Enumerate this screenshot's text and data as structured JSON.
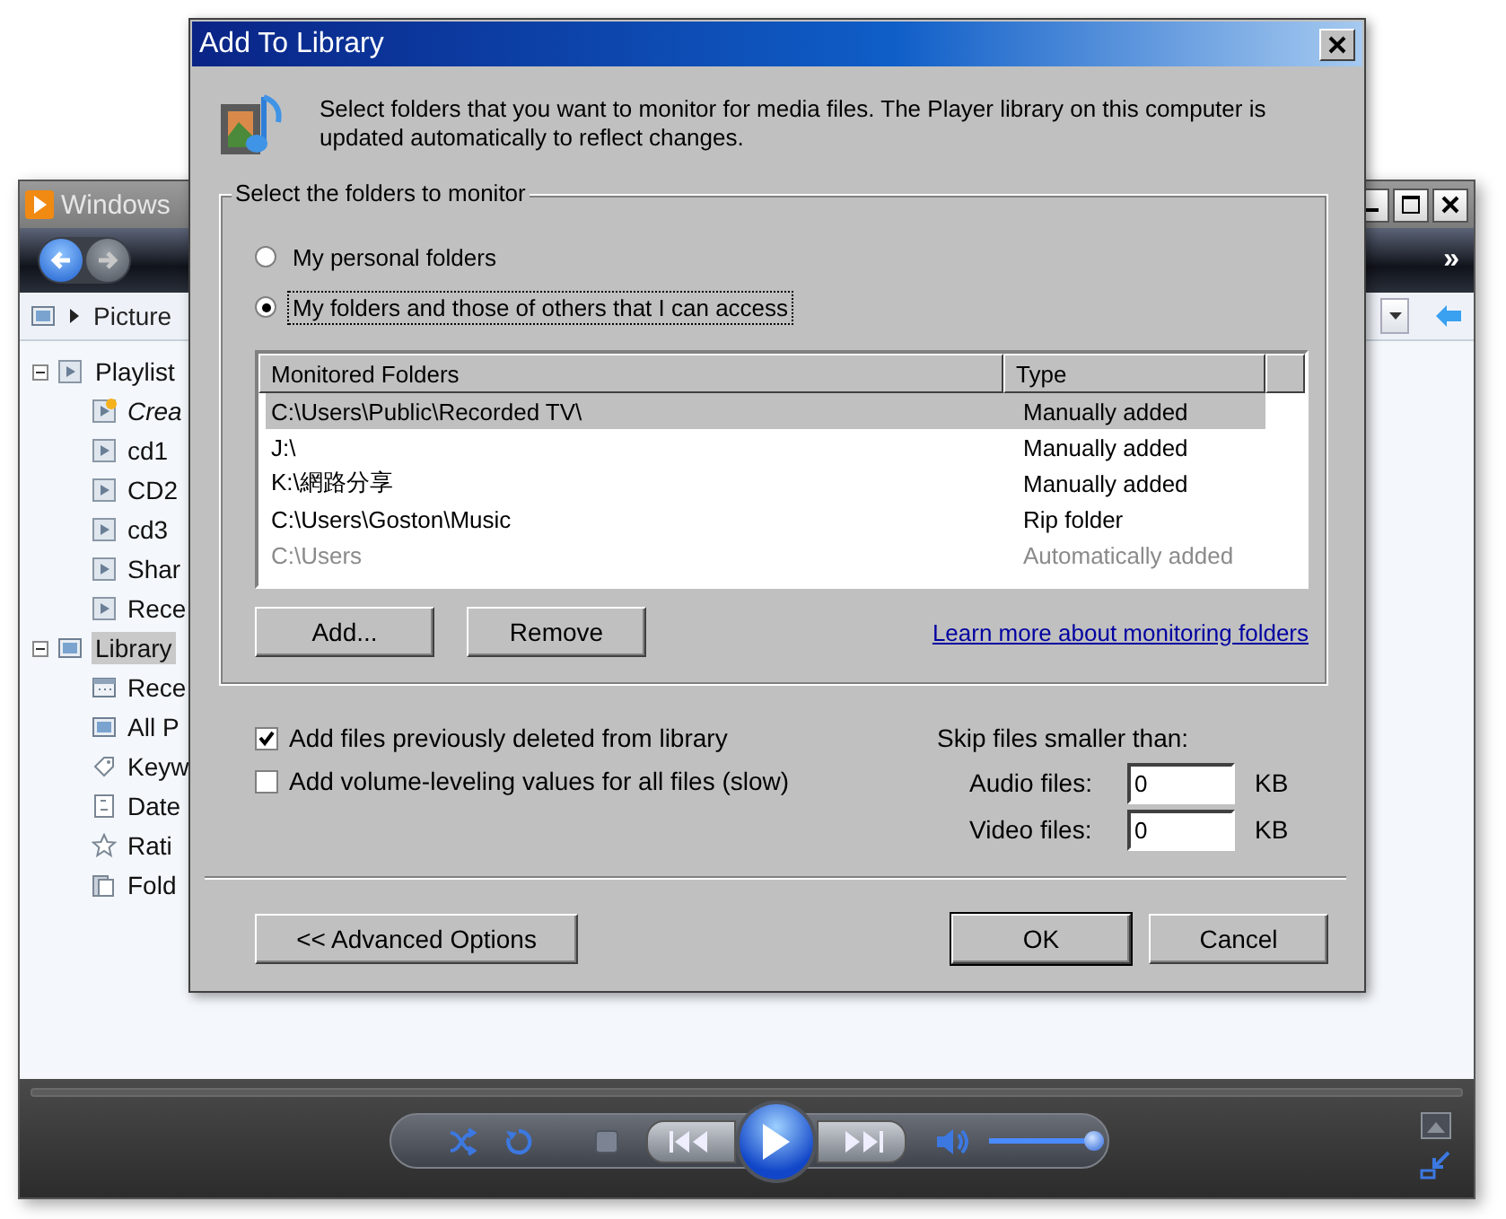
{
  "background_window": {
    "title": "Windows",
    "overflow": "»",
    "address": {
      "crumb": "Picture"
    },
    "tree": [
      {
        "label": "Playlist",
        "kind": "playlists",
        "expanded": true,
        "selected": false,
        "children": [
          {
            "label": "Crea",
            "kind": "new",
            "selected": false
          },
          {
            "label": "cd1",
            "kind": "playlist",
            "selected": false
          },
          {
            "label": "CD2",
            "kind": "playlist",
            "selected": false
          },
          {
            "label": "cd3",
            "kind": "playlist",
            "selected": false
          },
          {
            "label": "Shar",
            "kind": "playlist",
            "selected": false
          },
          {
            "label": "Rece",
            "kind": "playlist",
            "selected": false
          }
        ]
      },
      {
        "label": "Library",
        "kind": "library",
        "expanded": true,
        "selected": true,
        "children": [
          {
            "label": "Rece",
            "kind": "recent",
            "selected": false
          },
          {
            "label": "All P",
            "kind": "pictures",
            "selected": false
          },
          {
            "label": "Keyw",
            "kind": "tag",
            "selected": false
          },
          {
            "label": "Date",
            "kind": "date",
            "selected": false
          },
          {
            "label": "Rati",
            "kind": "star",
            "selected": false
          },
          {
            "label": "Fold",
            "kind": "folder",
            "selected": false
          }
        ]
      }
    ],
    "player": {
      "volume": {
        "level": 0.95
      }
    }
  },
  "dialog": {
    "title": "Add To Library",
    "description": "Select folders that you want to monitor for media files. The Player library on this computer is updated automatically to reflect changes.",
    "group_label": "Select the folders to monitor",
    "radios": [
      {
        "label": "My personal folders",
        "selected": false
      },
      {
        "label": "My folders and those of others that I can access",
        "selected": true
      }
    ],
    "table": {
      "columns": [
        "Monitored Folders",
        "Type"
      ],
      "rows": [
        {
          "cells": [
            "C:\\Users\\Public\\Recorded TV\\",
            "Manually added"
          ],
          "selected": true,
          "disabled": false
        },
        {
          "cells": [
            "J:\\",
            "Manually added"
          ],
          "selected": false,
          "disabled": false
        },
        {
          "cells": [
            "K:\\網路分享",
            "Manually added"
          ],
          "selected": false,
          "disabled": false
        },
        {
          "cells": [
            "C:\\Users\\Goston\\Music",
            "Rip folder"
          ],
          "selected": false,
          "disabled": false
        },
        {
          "cells": [
            "C:\\Users",
            "Automatically added"
          ],
          "selected": false,
          "disabled": true
        }
      ]
    },
    "list_buttons": [
      "Add...",
      "Remove"
    ],
    "link": "Learn more about monitoring folders",
    "options": [
      {
        "label": "Add files previously deleted from library",
        "checked": true
      },
      {
        "label": "Add volume-leveling values for all files (slow)",
        "checked": false
      }
    ],
    "skip": {
      "title": "Skip files smaller than:",
      "fields": [
        {
          "label": "Audio files:",
          "value": "0",
          "unit": "KB"
        },
        {
          "label": "Video files:",
          "value": "0",
          "unit": "KB"
        }
      ]
    },
    "footer_buttons": [
      {
        "label": "<< Advanced Options",
        "default": false
      },
      {
        "label": "OK",
        "default": true
      },
      {
        "label": "Cancel",
        "default": false
      }
    ]
  }
}
